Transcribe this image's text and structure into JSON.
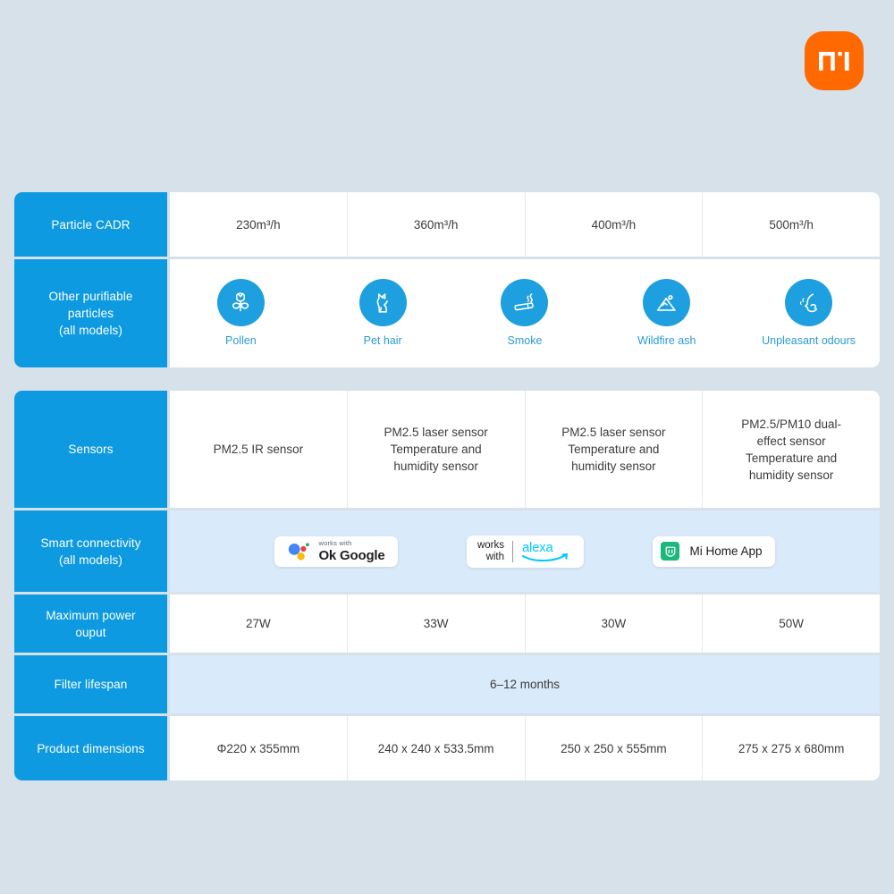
{
  "brand": {
    "logo_name": "mi-logo",
    "logo_color": "#FF6900",
    "logo_text": "MI"
  },
  "theme": {
    "page_background": "#d6e1ea",
    "label_blue": "#0d9ae0",
    "cell_white": "#ffffff",
    "merged_blue": "#d9eafa",
    "icon_blue": "#1d9fe0",
    "icon_label_blue": "#2b9ad6"
  },
  "tables": [
    {
      "id": "table-upper",
      "rows": [
        {
          "label": "Particle CADR",
          "type": "values",
          "cells": [
            "230m³/h",
            "360m³/h",
            "400m³/h",
            "500m³/h"
          ]
        },
        {
          "label": "Other purifiable\nparticles\n(all models)",
          "type": "icons",
          "icons": [
            {
              "name": "pollen-icon",
              "label": "Pollen"
            },
            {
              "name": "pet-hair-icon",
              "label": "Pet hair"
            },
            {
              "name": "smoke-icon",
              "label": "Smoke"
            },
            {
              "name": "wildfire-ash-icon",
              "label": "Wildfire ash"
            },
            {
              "name": "unpleasant-odours-icon",
              "label": "Unpleasant odours"
            }
          ]
        }
      ]
    },
    {
      "id": "table-lower",
      "rows": [
        {
          "label": "Sensors",
          "type": "values",
          "cells": [
            "PM2.5 IR sensor",
            "PM2.5 laser sensor\nTemperature and\nhumidity sensor",
            "PM2.5 laser sensor\nTemperature and\nhumidity sensor",
            "PM2.5/PM10 dual-\neffect sensor\nTemperature and\nhumidity sensor"
          ]
        },
        {
          "label": "Smart connectivity\n(all models)",
          "type": "badges",
          "badges": [
            {
              "name": "works-with-ok-google-badge",
              "small": "works with",
              "big": "Ok Google"
            },
            {
              "name": "works-with-alexa-badge",
              "line1": "works",
              "line2": "with",
              "brand": "alexa"
            },
            {
              "name": "mi-home-app-badge",
              "label": "Mi Home App"
            }
          ]
        },
        {
          "label": "Maximum power\nouput",
          "type": "values",
          "cells": [
            "27W",
            "33W",
            "30W",
            "50W"
          ]
        },
        {
          "label": "Filter lifespan",
          "type": "merged",
          "merged_value": "6–12 months"
        },
        {
          "label": "Product dimensions",
          "type": "values",
          "cells": [
            "Φ220 x 355mm",
            "240 x 240 x 533.5mm",
            "250 x 250 x 555mm",
            "275 x 275 x 680mm"
          ]
        }
      ]
    }
  ]
}
